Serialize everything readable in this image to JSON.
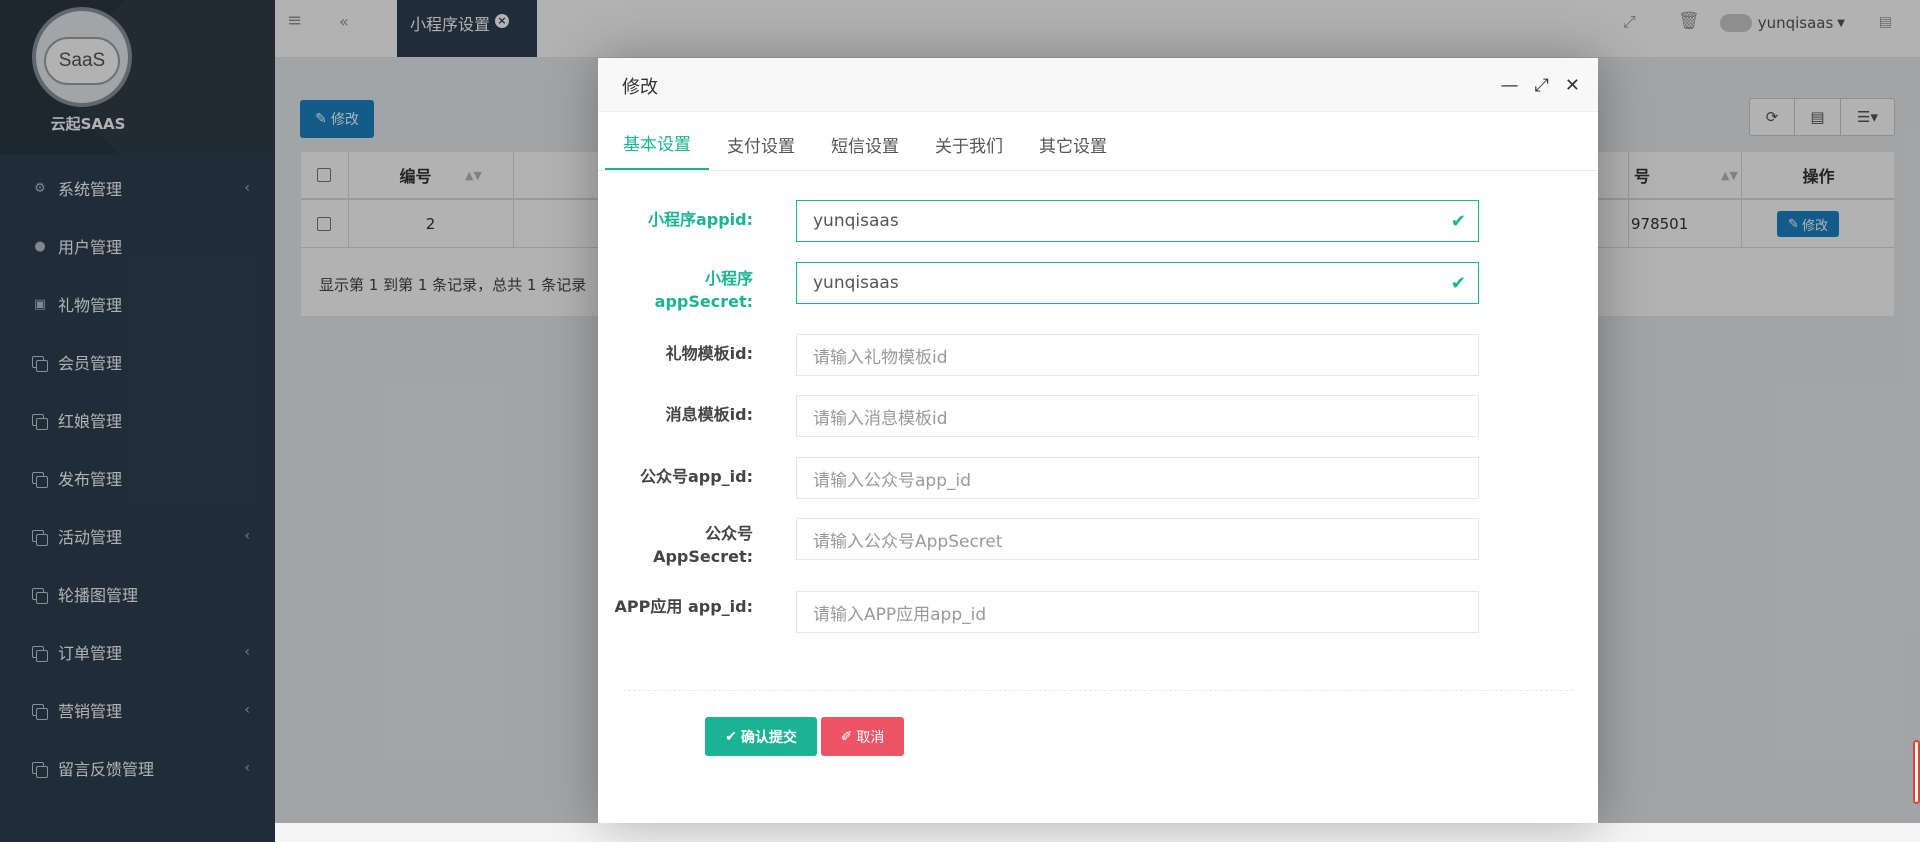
{
  "sidebar": {
    "logo_text": "SaaS",
    "brand": "云起SAAS",
    "items": [
      {
        "label": "系统管理",
        "icon": "gears-icon",
        "has_arrow": true
      },
      {
        "label": "用户管理",
        "icon": "user-icon",
        "has_arrow": false
      },
      {
        "label": "礼物管理",
        "icon": "gift-icon",
        "has_arrow": false
      },
      {
        "label": "会员管理",
        "icon": "copy-icon",
        "has_arrow": false
      },
      {
        "label": "红娘管理",
        "icon": "copy-icon",
        "has_arrow": false
      },
      {
        "label": "发布管理",
        "icon": "copy-icon",
        "has_arrow": false
      },
      {
        "label": "活动管理",
        "icon": "copy-icon",
        "has_arrow": true
      },
      {
        "label": "轮播图管理",
        "icon": "copy-icon",
        "has_arrow": false
      },
      {
        "label": "订单管理",
        "icon": "copy-icon",
        "has_arrow": true
      },
      {
        "label": "营销管理",
        "icon": "copy-icon",
        "has_arrow": true
      },
      {
        "label": "留言反馈管理",
        "icon": "copy-icon",
        "has_arrow": true
      }
    ]
  },
  "topbar": {
    "active_tab": "小程序设置",
    "username": "yunqisaas"
  },
  "page": {
    "edit_button": "修改",
    "table": {
      "headers": [
        "编号",
        "号",
        "操作"
      ],
      "row": {
        "id": "2",
        "partial_value": "978501",
        "action": "修改"
      },
      "footer": "显示第 1 到第 1 条记录，总共 1 条记录"
    }
  },
  "modal": {
    "title": "修改",
    "tabs": [
      "基本设置",
      "支付设置",
      "短信设置",
      "关于我们",
      "其它设置"
    ],
    "active_tab_index": 0,
    "fields": [
      {
        "label": "小程序appid:",
        "value": "yunqisaas",
        "placeholder": "",
        "valid": true
      },
      {
        "label": "小程序 appSecret:",
        "value": "yunqisaas",
        "placeholder": "",
        "valid": true
      },
      {
        "label": "礼物模板id:",
        "value": "",
        "placeholder": "请输入礼物模板id",
        "valid": false
      },
      {
        "label": "消息模板id:",
        "value": "",
        "placeholder": "请输入消息模板id",
        "valid": false
      },
      {
        "label": "公众号app_id:",
        "value": "",
        "placeholder": "请输入公众号app_id",
        "valid": false
      },
      {
        "label": "公众号 AppSecret:",
        "value": "",
        "placeholder": "请输入公众号AppSecret",
        "valid": false
      },
      {
        "label": "APP应用 app_id:",
        "value": "",
        "placeholder": "请输入APP应用app_id",
        "valid": false
      }
    ],
    "submit_label": "确认提交",
    "cancel_label": "取消"
  },
  "colors": {
    "sidebar_bg": "#2f4050",
    "accent_green": "#1ab394",
    "primary_blue": "#1c84c6",
    "danger_red": "#ed5565"
  }
}
